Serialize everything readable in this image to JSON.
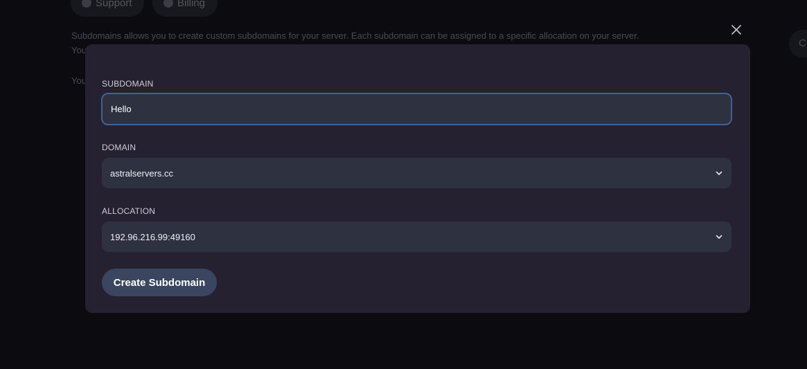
{
  "background": {
    "tabs": [
      {
        "label": "Support",
        "icon": "globe-icon"
      },
      {
        "label": "Billing",
        "icon": "billing-icon"
      }
    ],
    "description_line1": "Subdomains allows you to create custom subdomains for your server. Each subdomain can be assigned to a specific allocation on your server.",
    "description_line2": "You",
    "description_line3": "You",
    "right_button_label": "C"
  },
  "modal": {
    "close_icon": "close-icon",
    "subdomain": {
      "label": "SUBDOMAIN",
      "value": "Hello"
    },
    "domain": {
      "label": "DOMAIN",
      "selected": "astralservers.cc"
    },
    "allocation": {
      "label": "ALLOCATION",
      "selected": "192.96.216.99:49160"
    },
    "submit_label": "Create Subdomain"
  },
  "colors": {
    "modal_bg": "#262131",
    "input_bg": "#2e3140",
    "input_border": "#46608f",
    "button_bg": "#3a4660",
    "page_bg": "#0b0b10"
  }
}
